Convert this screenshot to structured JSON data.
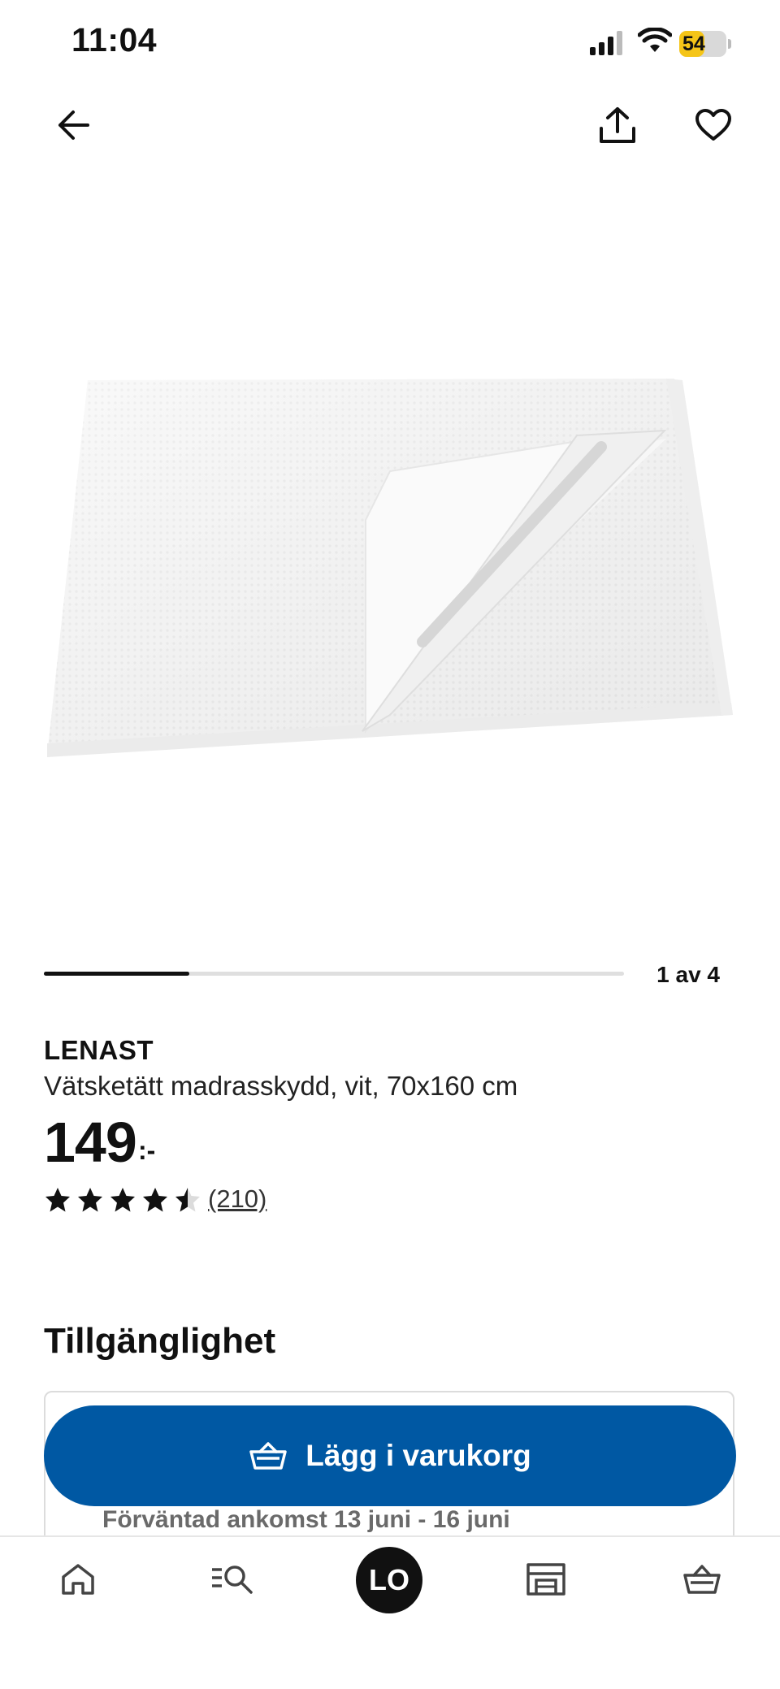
{
  "status_bar": {
    "time": "11:04",
    "battery_percent": "54",
    "battery_level": 0.54,
    "icons": [
      "signal-icon",
      "wifi-icon",
      "battery-charging-icon"
    ]
  },
  "header": {
    "back_icon": "arrow-left-icon",
    "share_icon": "share-icon",
    "favorite_icon": "heart-icon"
  },
  "gallery": {
    "image_subject": "folded white mattress protector",
    "counter": "1 av 4",
    "progress_fraction": 0.25
  },
  "product": {
    "name": "LENAST",
    "description": "Vätsketätt madrasskydd, vit, 70x160 cm",
    "price": "149",
    "price_suffix": ":-",
    "rating": 4.5,
    "review_count": "(210)"
  },
  "availability": {
    "title": "Tillgänglighet",
    "cart_button_label": "Lägg i varukorg",
    "cart_button_icon": "basket-icon",
    "delivery_estimate": "Förväntad ankomst 13 juni - 16 juni"
  },
  "colors": {
    "primary": "#0058a3",
    "battery": "#f5c518",
    "text": "#111111",
    "muted": "#6a6a6a"
  },
  "tab_bar": {
    "items": [
      {
        "icon": "home-icon"
      },
      {
        "icon": "search-list-icon"
      },
      {
        "label": "LO"
      },
      {
        "icon": "store-icon"
      },
      {
        "icon": "basket-icon"
      }
    ]
  }
}
